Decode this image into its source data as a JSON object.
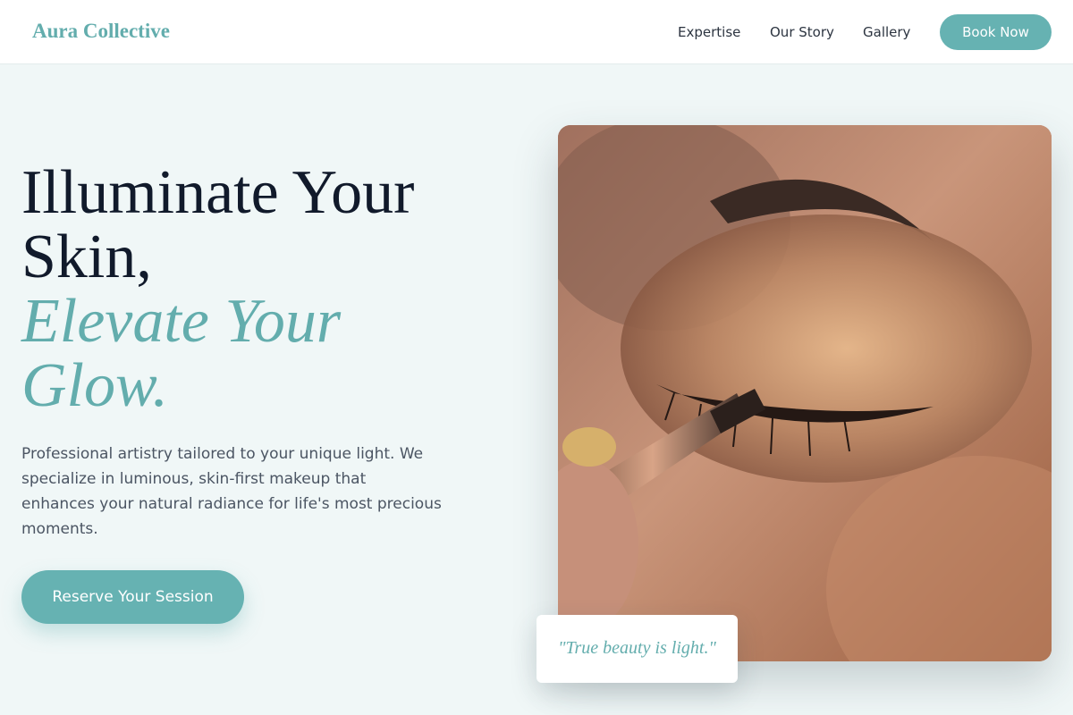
{
  "nav": {
    "brand": "Aura Collective",
    "links": [
      "Expertise",
      "Our Story",
      "Gallery"
    ],
    "cta": "Book Now"
  },
  "hero": {
    "title_line1": "Illuminate Your Skin,",
    "title_line2": "Elevate Your Glow.",
    "description": "Professional artistry tailored to your unique light. We specialize in luminous, skin-first makeup that enhances your natural radiance for life's most precious moments.",
    "cta": "Reserve Your Session",
    "quote": "\"True beauty is light.\""
  },
  "colors": {
    "accent": "#66b2b2",
    "background": "#f0f7f7",
    "heading": "#111a2b",
    "body_text": "#4b5563"
  },
  "image": {
    "subject": "close-up of makeup brush applying shimmer eyeshadow"
  }
}
